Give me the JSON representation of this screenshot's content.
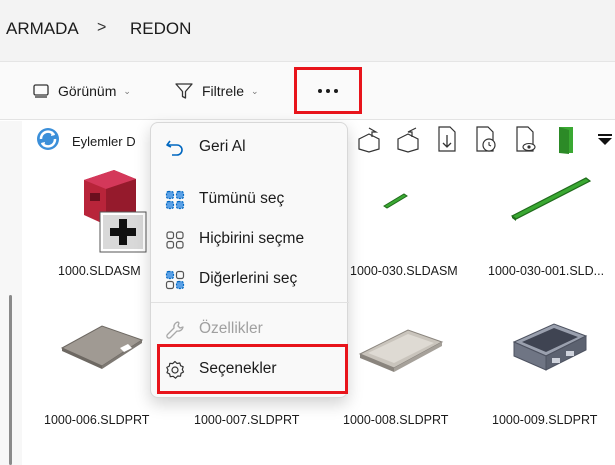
{
  "breadcrumb": {
    "items": [
      "ARMADA",
      "REDON"
    ],
    "separator": ">"
  },
  "commandbar": {
    "view_label": "Görünüm",
    "filter_label": "Filtrele",
    "more_label": "...",
    "view_icon": "monitor-icon",
    "filter_icon": "funnel-icon"
  },
  "pdm_toolbar": {
    "actions_label": "Eylemler",
    "actions_truncated": "D"
  },
  "files": [
    {
      "name": "1000.SLDASM",
      "type": "assembly"
    },
    {
      "name": "1000-030.SLDASM",
      "type": "assembly"
    },
    {
      "name": "1000-030-001.SLD...",
      "type": "part"
    },
    {
      "name": "1000-006.SLDPRT",
      "type": "part"
    },
    {
      "name": "1000-007.SLDPRT",
      "type": "part"
    },
    {
      "name": "1000-008.SLDPRT",
      "type": "part"
    },
    {
      "name": "1000-009.SLDPRT",
      "type": "part"
    }
  ],
  "menu": {
    "items": [
      {
        "label": "Geri Al",
        "icon": "undo-icon",
        "enabled": true
      },
      {
        "label": "Tümünü seç",
        "icon": "select-all-icon",
        "enabled": true
      },
      {
        "label": "Hiçbirini seçme",
        "icon": "select-none-icon",
        "enabled": true
      },
      {
        "label": "Diğerlerini seç",
        "icon": "invert-selection-icon",
        "enabled": true
      },
      {
        "label": "Özellikler",
        "icon": "wrench-icon",
        "enabled": false
      },
      {
        "label": "Seçenekler",
        "icon": "settings-gear-icon",
        "enabled": true
      }
    ]
  },
  "colors": {
    "highlight": "#e8141b",
    "accent": "#0067c0",
    "green_part": "#3aa832"
  }
}
